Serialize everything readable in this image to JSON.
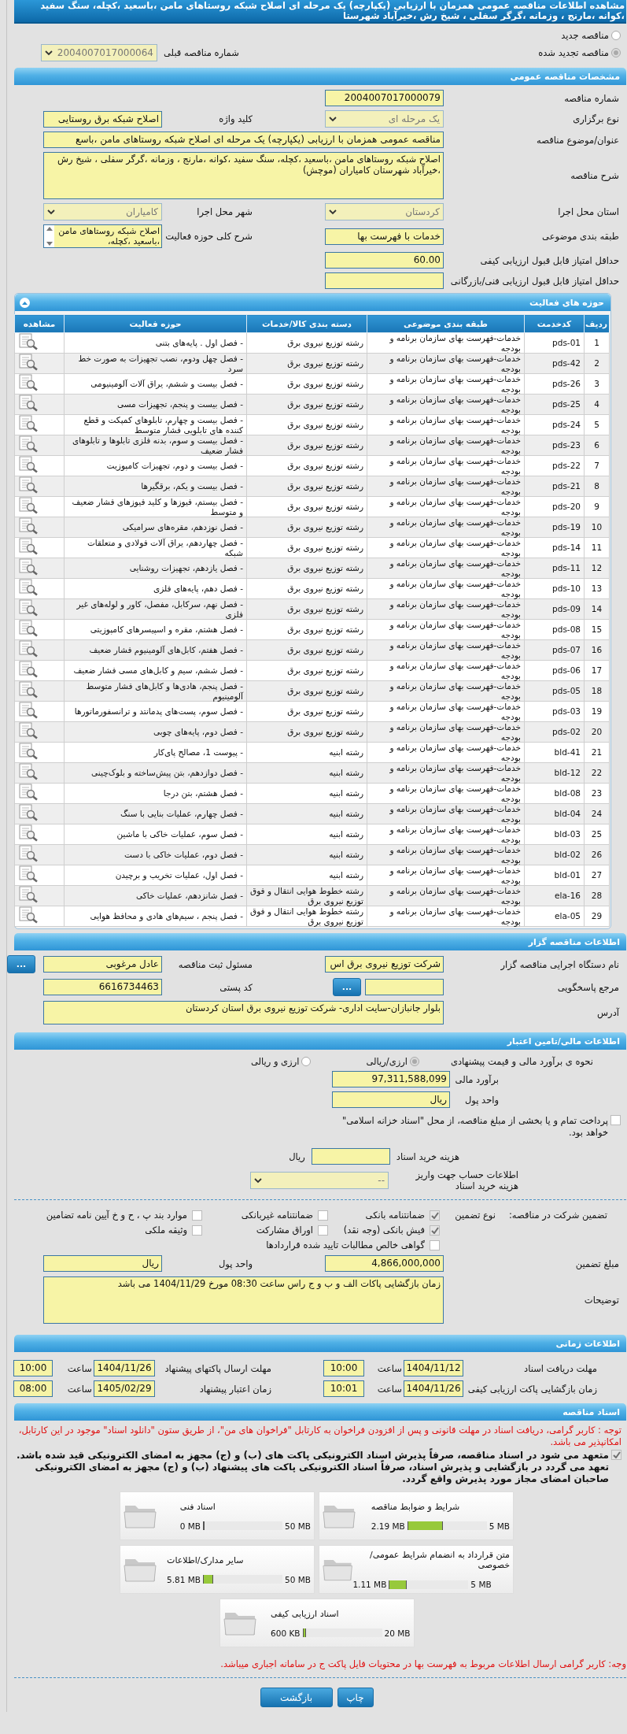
{
  "title": "مشاهده اطلاعات مناقصه عمومی همزمان با ارزیابی (یکپارچه) یک مرحله ای اصلاح شبکه روستاهای مامن ،باسعید ،کچله، سنگ سفید ،کوانه ،مارنج ، وزمانه ،گرگر سفلی ، شیخ رش ،خیرآباد شهرستا",
  "tender_type": {
    "options": [
      {
        "label": "مناقصه جدید",
        "selected": false
      },
      {
        "label": "مناقصه تجدید شده",
        "selected": true
      }
    ],
    "previous_label": "شماره مناقصه قبلی",
    "previous_value": "2004007017000064"
  },
  "general": {
    "heading": "مشخصات مناقصه عمومی",
    "rows": [
      {
        "right": {
          "label": "شماره مناقصه",
          "kind": "input",
          "value": "2004007017000079"
        }
      },
      {
        "right": {
          "label": "نوع برگزاری",
          "kind": "select",
          "value": "یک مرحله ای"
        },
        "left": {
          "label": "کلید واژه",
          "kind": "input",
          "value": "اصلاح شبکه برق روستایی"
        }
      },
      {
        "right": {
          "label": "عنوان/موضوع مناقصه",
          "kind": "wide-input",
          "value": "مناقصه عمومی همزمان با ارزیابی (یکپارچه) یک مرحله ای اصلاح شبکه روستاهای مامن ،باسع"
        }
      },
      {
        "right": {
          "label": "شرح مناقصه",
          "kind": "textarea",
          "value": "اصلاح شبکه روستاهای مامن ،باسعید ،کچله، سنگ سفید ،کوانه ،مارنج ، وزمانه ،گرگر سفلی ، شیخ رش ،خیرآباد شهرستان کامیاران (موچش)"
        }
      },
      {
        "right": {
          "label": "استان محل اجرا",
          "kind": "select",
          "value": "کردستان"
        },
        "left": {
          "label": "شهر محل اجرا",
          "kind": "select",
          "value": "کامیاران"
        }
      },
      {
        "right": {
          "label": "طبقه بندی موضوعی",
          "kind": "input",
          "value": "خدمات با فهرست بها"
        },
        "left": {
          "label": "شرح کلی حوزه فعالیت",
          "kind": "listbox",
          "value": "اصلاح شبکه روستاهای مامن ،باسعید ،کچله،"
        }
      },
      {
        "right": {
          "label": "حداقل امتیاز قابل قبول ارزیابی کیفی",
          "kind": "input",
          "value": "60.00"
        }
      },
      {
        "right": {
          "label": "حداقل امتیاز قابل قبول ارزیابی فنی/بازرگانی",
          "kind": "input"
        }
      }
    ]
  },
  "activities": {
    "heading": "حوزه های فعالیت",
    "columns": [
      "ردیف",
      "کدخدمت",
      "طبقه بندی موضوعی",
      "دسته بندی کالا/خدمات",
      "حوزه فعالیت",
      "مشاهده"
    ],
    "rows": [
      {
        "cells": [
          "1",
          "pds-01",
          "خدمات-فهرست بهای سازمان برنامه و بودجه",
          "رشته توزیع نیروی برق",
          "- فصل اول . پایه‌های بتنی"
        ]
      },
      {
        "cells": [
          "2",
          "pds-42",
          "خدمات-فهرست بهای سازمان برنامه و بودجه",
          "رشته توزیع نیروی برق",
          "- فصل چهل ودوم، نصب تجهیزات به صورت خط سرد"
        ]
      },
      {
        "cells": [
          "3",
          "pds-26",
          "خدمات-فهرست بهای سازمان برنامه و بودجه",
          "رشته توزیع نیروی برق",
          "- فصل بیست و ششم، یراق آلات آلومینیومی"
        ]
      },
      {
        "cells": [
          "4",
          "pds-25",
          "خدمات-فهرست بهای سازمان برنامه و بودجه",
          "رشته توزیع نیروی برق",
          "- فصل بیست و پنجم، تجهیزات مسی"
        ]
      },
      {
        "cells": [
          "5",
          "pds-24",
          "خدمات-فهرست بهای سازمان برنامه و بودجه",
          "رشته توزیع نیروی برق",
          "- فصل بیست و چهارم، تابلوهای کمپکت و قطع کننده های تابلویی فشار متوسط"
        ]
      },
      {
        "cells": [
          "6",
          "pds-23",
          "خدمات-فهرست بهای سازمان برنامه و بودجه",
          "رشته توزیع نیروی برق",
          "- فصل بیست و سوم، بدنه فلزی تابلوها و تابلوهای فشار ضعیف"
        ]
      },
      {
        "cells": [
          "7",
          "pds-22",
          "خدمات-فهرست بهای سازمان برنامه و بودجه",
          "رشته توزیع نیروی برق",
          "- فصل بیست و دوم، تجهیزات کامپوزیت"
        ]
      },
      {
        "cells": [
          "8",
          "pds-21",
          "خدمات-فهرست بهای سازمان برنامه و بودجه",
          "رشته توزیع نیروی برق",
          "- فصل بیست و یکم، برقگیرها"
        ]
      },
      {
        "cells": [
          "9",
          "pds-20",
          "خدمات-فهرست بهای سازمان برنامه و بودجه",
          "رشته توزیع نیروی برق",
          "- فصل بیستم، فیوزها و کلید فیوزهای فشار ضعیف و متوسط"
        ]
      },
      {
        "cells": [
          "10",
          "pds-19",
          "خدمات-فهرست بهای سازمان برنامه و بودجه",
          "رشته توزیع نیروی برق",
          "- فصل نوزدهم، مقره‌های سرامیکی"
        ]
      },
      {
        "cells": [
          "11",
          "pds-14",
          "خدمات-فهرست بهای سازمان برنامه و بودجه",
          "رشته توزیع نیروی برق",
          "- فصل چهاردهم، یراق آلات فولادی و متعلقات شبکه"
        ]
      },
      {
        "cells": [
          "12",
          "pds-11",
          "خدمات-فهرست بهای سازمان برنامه و بودجه",
          "رشته توزیع نیروی برق",
          "- فصل یازدهم، تجهیزات روشنایی"
        ]
      },
      {
        "cells": [
          "13",
          "pds-10",
          "خدمات-فهرست بهای سازمان برنامه و بودجه",
          "رشته توزیع نیروی برق",
          "- فصل دهم، پایه‌های فلزی"
        ]
      },
      {
        "cells": [
          "14",
          "pds-09",
          "خدمات-فهرست بهای سازمان برنامه و بودجه",
          "رشته توزیع نیروی برق",
          "- فصل نهم، سرکابل، مفصل، کاور و لوله‌های غیر فلزی"
        ]
      },
      {
        "cells": [
          "15",
          "pds-08",
          "خدمات-فهرست بهای سازمان برنامه و بودجه",
          "رشته توزیع نیروی برق",
          "- فصل هشتم، مقره و اسپیسرهای کامپوزیتی"
        ]
      },
      {
        "cells": [
          "16",
          "pds-07",
          "خدمات-فهرست بهای سازمان برنامه و بودجه",
          "رشته توزیع نیروی برق",
          "- فصل هفتم، کابل‌های آلومینیوم فشار ضعیف"
        ]
      },
      {
        "cells": [
          "17",
          "pds-06",
          "خدمات-فهرست بهای سازمان برنامه و بودجه",
          "رشته توزیع نیروی برق",
          "- فصل ششم، سیم و کابل‌های مسی فشار ضعیف"
        ]
      },
      {
        "cells": [
          "18",
          "pds-05",
          "خدمات-فهرست بهای سازمان برنامه و بودجه",
          "رشته توزیع نیروی برق",
          "- فصل پنجم، هادی‌ها و کابل‌های فشار متوسط آلومینیوم"
        ]
      },
      {
        "cells": [
          "19",
          "pds-03",
          "خدمات-فهرست بهای سازمان برنامه و بودجه",
          "رشته توزیع نیروی برق",
          "- فصل سوم، پست‌های پدمانتد و ترانسفورماتورها"
        ]
      },
      {
        "cells": [
          "20",
          "pds-02",
          "خدمات-فهرست بهای سازمان برنامه و بودجه",
          "رشته توزیع نیروی برق",
          "- فصل دوم، پایه‌های چوبی"
        ]
      },
      {
        "cells": [
          "21",
          "bld-41",
          "خدمات-فهرست بهای سازمان برنامه و بودجه",
          "رشته ابنیه",
          "- پیوست 1، مصالح پای‌کار"
        ]
      },
      {
        "cells": [
          "22",
          "bld-12",
          "خدمات-فهرست بهای سازمان برنامه و بودجه",
          "رشته ابنیه",
          "- فصل دوازدهم، بتن پیش‌ساخته و بلوک‌چینی"
        ]
      },
      {
        "cells": [
          "23",
          "bld-08",
          "خدمات-فهرست بهای سازمان برنامه و بودجه",
          "رشته ابنیه",
          "- فصل هشتم، بتن درجا"
        ]
      },
      {
        "cells": [
          "24",
          "bld-04",
          "خدمات-فهرست بهای سازمان برنامه و بودجه",
          "رشته ابنیه",
          "- فصل چهارم، عملیات بنایی با سنگ"
        ]
      },
      {
        "cells": [
          "25",
          "bld-03",
          "خدمات-فهرست بهای سازمان برنامه و بودجه",
          "رشته ابنیه",
          "- فصل سوم، عملیات خاکی با ماشین"
        ]
      },
      {
        "cells": [
          "26",
          "bld-02",
          "خدمات-فهرست بهای سازمان برنامه و بودجه",
          "رشته ابنیه",
          "- فصل دوم، عملیات خاکی با دست"
        ]
      },
      {
        "cells": [
          "27",
          "bld-01",
          "خدمات-فهرست بهای سازمان برنامه و بودجه",
          "رشته ابنیه",
          "- فصل اول، عملیات تخریب و برچیدن"
        ]
      },
      {
        "cells": [
          "28",
          "ela-16",
          "خدمات-فهرست بهای سازمان برنامه و بودجه",
          "رشته خطوط هوایی انتقال و فوق توزیع نیروی برق",
          "- فصل شانزدهم، عملیات خاکی"
        ]
      },
      {
        "cells": [
          "29",
          "ela-05",
          "خدمات-فهرست بهای سازمان برنامه و بودجه",
          "رشته خطوط هوایی انتقال و فوق توزیع نیروی برق",
          "- فصل پنجم ، سیم‌های هادی و محافظ هوایی"
        ]
      }
    ]
  },
  "organizer": {
    "heading": "اطلاعات مناقصه گزار",
    "rows": [
      {
        "right": {
          "label": "نام دستگاه اجرایی مناقصه گزار",
          "kind": "input",
          "value": "شرکت توزیع نیروی برق اس"
        },
        "left": {
          "label": "مسئول ثبت مناقصه",
          "kind": "input",
          "value": "عادل مرغوبی",
          "button": "..."
        }
      },
      {
        "right": {
          "label": "مرجع پاسخگویی",
          "kind": "input",
          "button": "..."
        },
        "left": {
          "label": "کد پستی",
          "kind": "input",
          "value": "6616734463"
        }
      },
      {
        "right": {
          "label": "آدرس",
          "kind": "address",
          "value": "بلوار جانبازان-سایت اداری- شرکت توزیع نیروی برق استان کردستان"
        }
      }
    ]
  },
  "financial": {
    "heading": "اطلاعات مالی/تامین اعتبار",
    "method": {
      "label": "نحوه ی برآورد مالی و قیمت پیشنهادی",
      "options": [
        {
          "label": "ارزی/ریالی",
          "selected": true
        },
        {
          "label": "ارزی و ریالی",
          "selected": false
        }
      ]
    },
    "estimate": {
      "label": "برآورد مالی",
      "value": "97,311,588,099"
    },
    "currency": {
      "label": "واحد پول",
      "value": "ریال"
    },
    "treasury": {
      "label": "پرداخت تمام و یا بخشی از مبلغ مناقصه، از محل \"اسناد خزانه اسلامی\" خواهد بود.",
      "checked": false
    },
    "doc_fee": {
      "label": "هزینه خرید اسناد",
      "unit": "ریال"
    },
    "account": {
      "label": "اطلاعات حساب جهت واریز هزینه خرید اسناد",
      "value": "--"
    },
    "guarantee": {
      "label": "تضمین شرکت در مناقصه:",
      "type_label": "نوع تضمین",
      "options": [
        {
          "label": "ضمانتنامه بانکی",
          "checked": true
        },
        {
          "label": "ضمانتنامه غیربانکی",
          "checked": false
        },
        {
          "label": "موارد بند پ ، ح و خ آیین نامه تضامین",
          "checked": false
        },
        {
          "label": "فیش بانکی (وجه نقد)",
          "checked": true
        },
        {
          "label": "اوراق مشارکت",
          "checked": false
        },
        {
          "label": "وثیقه ملکی",
          "checked": false
        },
        {
          "label": "گواهی خالص مطالبات تایید شده قراردادها",
          "checked": false
        }
      ]
    },
    "rows": [
      {
        "right": {
          "label": "مبلغ تضمین",
          "kind": "input",
          "value": "4,866,000,000"
        },
        "left": {
          "label": "واحد پول",
          "kind": "input",
          "value": "ریال"
        }
      },
      {
        "right": {
          "label": "توضیحات",
          "kind": "textarea",
          "value": "زمان بازگشایی پاکات الف و ب و ج راس ساعت 08:30 مورخ 1404/11/29 می باشد"
        }
      }
    ]
  },
  "timing": {
    "heading": "اطلاعات زمانی",
    "items": [
      {
        "label": "مهلت دریافت اسناد",
        "date": "1404/11/12",
        "time_label": "ساعت",
        "time": "10:00"
      },
      {
        "label": "مهلت ارسال پاکتهای پیشنهاد",
        "date": "1404/11/26",
        "time_label": "ساعت",
        "time": "10:00"
      },
      {
        "label": "زمان بازگشایی پاکت ارزیابی کیفی",
        "date": "1404/11/26",
        "time_label": "ساعت",
        "time": "10:01"
      },
      {
        "label": "زمان اعتبار پیشنهاد",
        "date": "1405/02/29",
        "time_label": "ساعت",
        "time": "08:00"
      }
    ]
  },
  "documents": {
    "heading": "اسناد مناقصه",
    "notice": "توجه : کاربر گرامی، دریافت اسناد در مهلت قانونی و پس از افزودن فراخوان به کارتابل \"فراخوان های من\"، از طریق ستون \"دانلود اسناد\" موجود در این کارتابل، امکانپذیر می باشد.",
    "commitment": {
      "text": "متعهد می شود در اسناد مناقصه، صرفاً پذیرش اسناد الکترونیکی پاکت های (ب) و (ج) مجهز به امضای الکترونیکی قید شده باشد. تعهد می گردد در بازگشایی و پذیرش اسناد، صرفاً اسناد الکترونیکی پاکت های پیشنهاد (ب) و (ج) مجهز به امضای الکترونیکی صاحبان امضای مجاز مورد پذیرش واقع گردد.",
      "checked": true
    },
    "files": [
      {
        "name": "شرایط و ضوابط مناقصه",
        "size": "2.19 MB",
        "max": "5 MB",
        "level": 0.44
      },
      {
        "name": "اسناد فنی",
        "size": "0 MB",
        "max": "50 MB",
        "level": 0
      },
      {
        "name": "متن قرارداد به انضمام شرایط عمومی/خصوصی",
        "size": "1.11 MB",
        "max": "5 MB",
        "level": 0.22
      },
      {
        "name": "سایر مدارک/اطلاعات",
        "size": "5.81 MB",
        "max": "50 MB",
        "level": 0.12
      },
      {
        "name": "اسناد ارزیابی کیفی",
        "size": "600 KB",
        "max": "20 MB",
        "level": 0.03
      }
    ],
    "footer_note": "وجه: کاربر گرامی ارسال اطلاعات مربوط به فهرست بها در محتویات فایل پاکت ج در سامانه اجباری میباشد."
  },
  "buttons": [
    "چاپ",
    "بازگشت"
  ]
}
